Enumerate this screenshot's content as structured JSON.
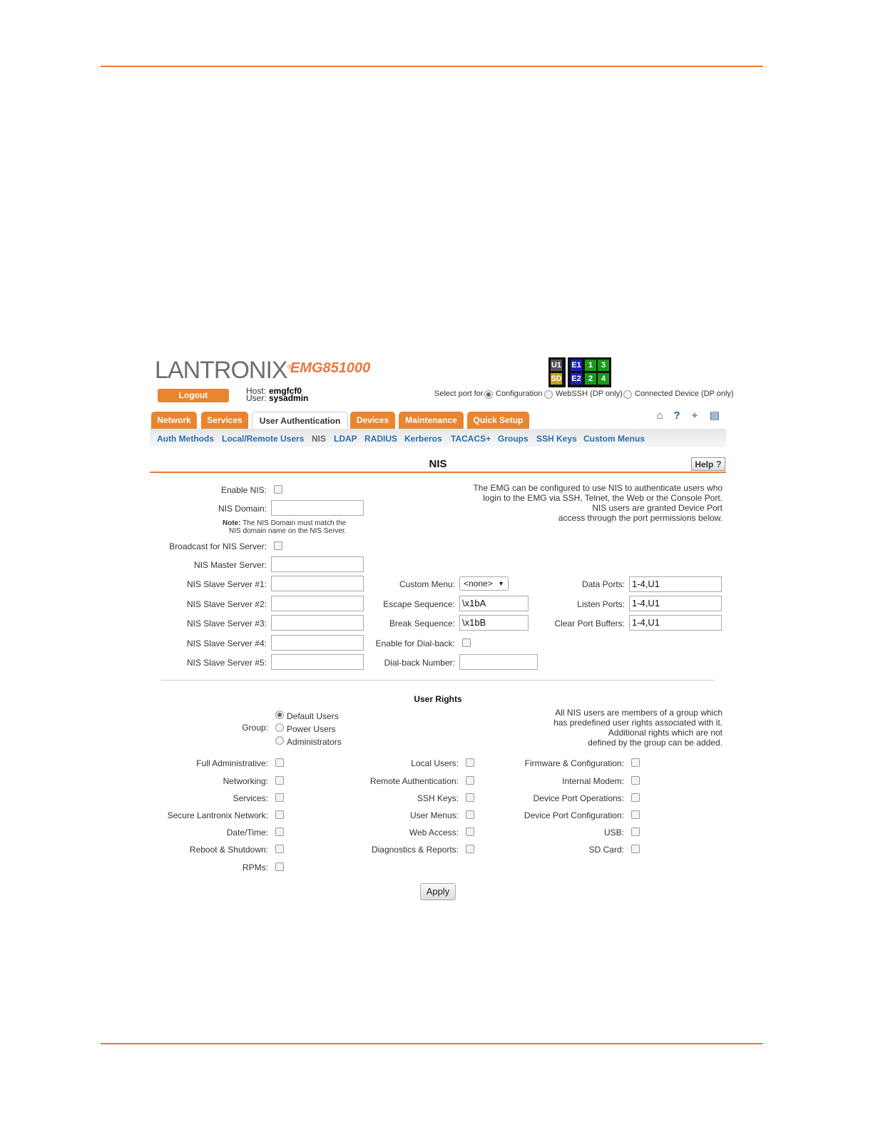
{
  "brand": {
    "logo": "LANTRONIX",
    "registered": "®",
    "model": "EMG851000"
  },
  "header": {
    "logout": "Logout",
    "host_label": "Host:",
    "host_value": "emgfcf0",
    "user_label": "User:",
    "user_value": "sysadmin",
    "select_port_label": "Select port for",
    "port_options": [
      "Configuration",
      "WebSSH (DP only)",
      "Connected Device (DP only)"
    ],
    "status_tiles": [
      "U1",
      "E1",
      "1",
      "3",
      "SD",
      "E2",
      "2",
      "4"
    ]
  },
  "tabs": [
    "Network",
    "Services",
    "User Authentication",
    "Devices",
    "Maintenance",
    "Quick Setup"
  ],
  "subtabs": [
    "Auth Methods",
    "Local/Remote Users",
    "NIS",
    "LDAP",
    "RADIUS",
    "Kerberos",
    "TACACS+",
    "Groups",
    "SSH Keys",
    "Custom Menus"
  ],
  "page": {
    "title": "NIS",
    "help": "Help",
    "help_icon": "?"
  },
  "form": {
    "enable_nis": "Enable NIS:",
    "nis_domain": "NIS Domain:",
    "note_bold": "Note:",
    "note_text1": "The NIS Domain must match the",
    "note_text2": "NIS domain name on the NIS Server.",
    "broadcast": "Broadcast for NIS Server:",
    "master": "NIS Master Server:",
    "slaves": [
      "NIS Slave Server #1:",
      "NIS Slave Server #2:",
      "NIS Slave Server #3:",
      "NIS Slave Server #4:",
      "NIS Slave Server #5:"
    ],
    "description": [
      "The EMG can be configured to use NIS to authenticate users who",
      "login to the EMG via SSH, Telnet, the Web or the Console Port.",
      "NIS users are granted Device Port",
      "access through the port permissions below."
    ],
    "custom_menu": "Custom Menu:",
    "custom_menu_value": "<none>",
    "escape": "Escape Sequence:",
    "escape_value": "\\x1bA",
    "break": "Break Sequence:",
    "break_value": "\\x1bB",
    "dialback": "Enable for Dial-back:",
    "dialback_number": "Dial-back Number:",
    "data_ports": "Data Ports:",
    "data_ports_value": "1-4,U1",
    "listen_ports": "Listen Ports:",
    "listen_ports_value": "1-4,U1",
    "clear_buffers": "Clear Port Buffers:",
    "clear_buffers_value": "1-4,U1"
  },
  "rights": {
    "title": "User Rights",
    "group_label": "Group:",
    "groups": [
      "Default Users",
      "Power Users",
      "Administrators"
    ],
    "description": [
      "All NIS users are members of a group which",
      "has predefined user rights associated with it.",
      "Additional rights which are not",
      "defined by the group can be added."
    ],
    "col1": [
      "Full Administrative:",
      "Networking:",
      "Services:",
      "Secure Lantronix Network:",
      "Date/Time:",
      "Reboot & Shutdown:",
      "RPMs:"
    ],
    "col2": [
      "Local Users:",
      "Remote Authentication:",
      "SSH Keys:",
      "User Menus:",
      "Web Access:",
      "Diagnostics & Reports:"
    ],
    "col3": [
      "Firmware & Configuration:",
      "Internal Modem:",
      "Device Port Operations:",
      "Device Port Configuration:",
      "USB:",
      "SD Card:"
    ]
  },
  "apply": "Apply",
  "colors": {
    "accent": "#e8783c",
    "tab": "#e8852e",
    "link": "#2a6fb0"
  }
}
